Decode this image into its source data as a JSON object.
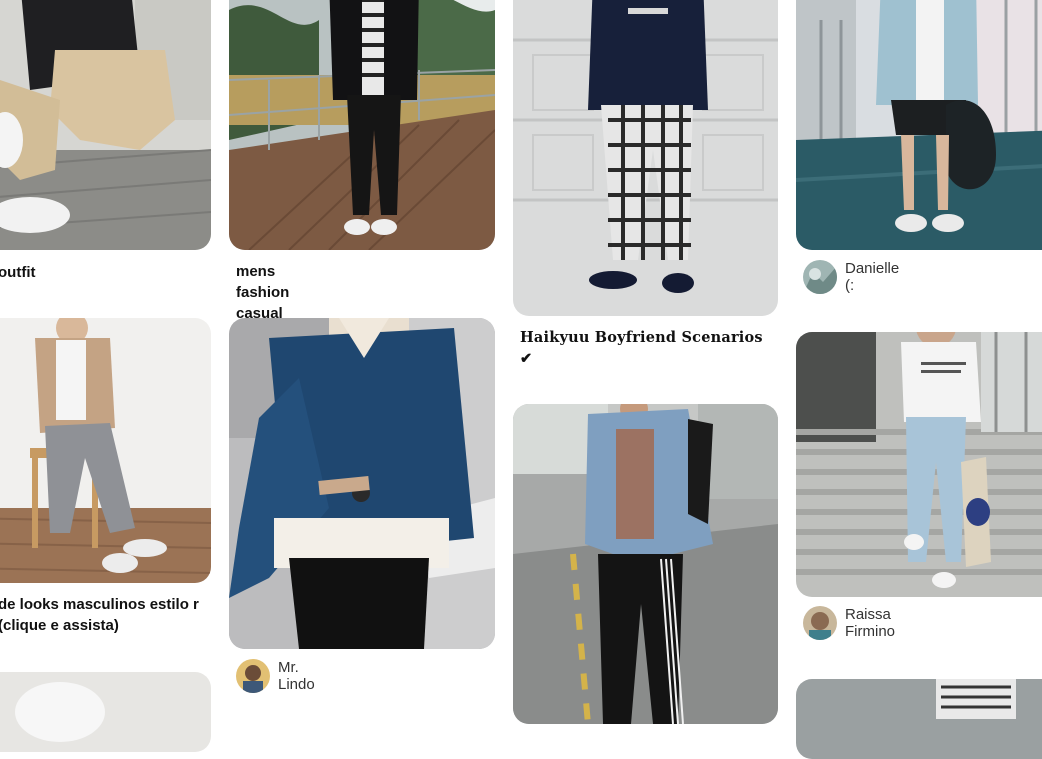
{
  "feed": {
    "pins": [
      {
        "title": "outfit"
      },
      {
        "title": "mens fashion casual rugged"
      },
      {
        "title": "Haikyuu Boyfriend Scenarios ✔"
      },
      {
        "author": "Danielle (:"
      },
      {
        "title": "de looks masculinos estilo r (clique e assista)"
      },
      {
        "author": "Mr. Lindo"
      },
      {
        "author": "Raissa Firmino"
      }
    ]
  },
  "colors": {
    "background": "#ffffff",
    "title_text": "#111111",
    "author_text": "#333333"
  }
}
